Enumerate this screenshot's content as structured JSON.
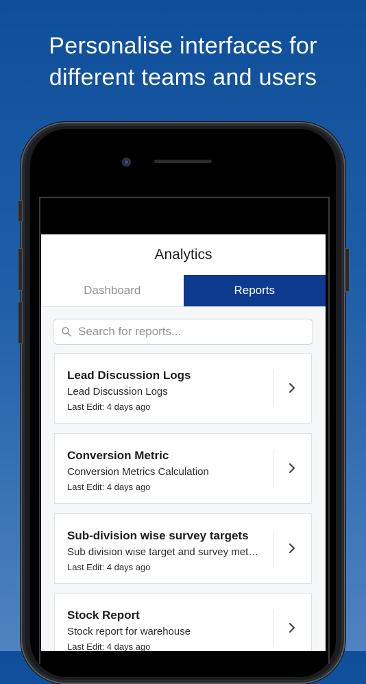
{
  "headline": {
    "line1": "Personalise interfaces for",
    "line2": "different teams and users"
  },
  "app": {
    "title": "Analytics",
    "tabs": [
      {
        "label": "Dashboard",
        "active": false
      },
      {
        "label": "Reports",
        "active": true
      }
    ],
    "search": {
      "placeholder": "Search for reports..."
    },
    "reports": [
      {
        "title": "Lead Discussion Logs",
        "subtitle": "Lead Discussion Logs",
        "last_edit": "Last Edit: 4 days ago"
      },
      {
        "title": "Conversion Metric",
        "subtitle": "Conversion Metrics Calculation",
        "last_edit": "Last Edit: 4 days ago"
      },
      {
        "title": "Sub-division wise survey targets",
        "subtitle": "Sub division wise target and survey metrics",
        "last_edit": "Last Edit: 4 days ago"
      },
      {
        "title": "Stock Report",
        "subtitle": "Stock report for warehouse",
        "last_edit": "Last Edit: 4 days ago"
      }
    ]
  },
  "colors": {
    "accent": "#0d3a8f",
    "background_top": "#0f4e9a",
    "background_bottom": "#4f83c0"
  }
}
